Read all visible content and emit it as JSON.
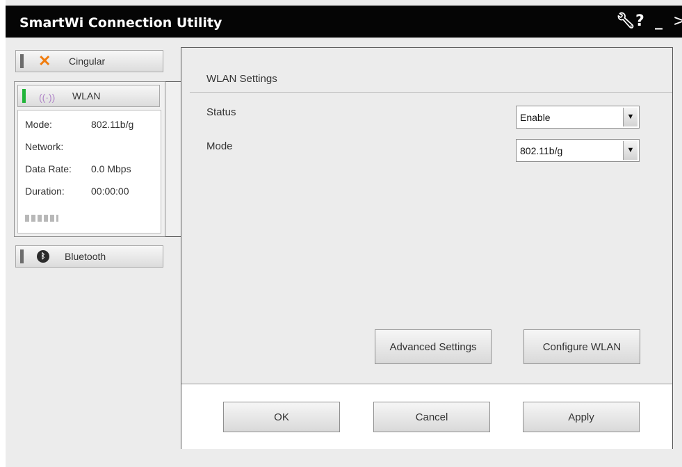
{
  "window": {
    "title": "SmartWi Connection Utility"
  },
  "title_controls": {
    "settings": "✎",
    "help": "?",
    "minimize": "_",
    "close": ">"
  },
  "sidebar": {
    "items": [
      {
        "label": "Cingular",
        "icon": "cingular-logo-icon"
      },
      {
        "label": "WLAN",
        "icon": "wifi-signal-icon",
        "selected": true
      },
      {
        "label": "Bluetooth",
        "icon": "bluetooth-icon"
      }
    ],
    "wlan_info": {
      "mode_label": "Mode:",
      "mode_value": "802.11b/g",
      "network_label": "Network:",
      "network_value": "",
      "rate_label": "Data Rate:",
      "rate_value": "0.0 Mbps",
      "duration_label": "Duration:",
      "duration_value": "00:00:00"
    }
  },
  "panel": {
    "title": "WLAN Settings",
    "status": {
      "label": "Status",
      "value": "Enable"
    },
    "mode": {
      "label": "Mode",
      "value": "802.11b/g"
    },
    "advanced_label": "Advanced Settings",
    "configure_label": "Configure WLAN"
  },
  "footer": {
    "ok": "OK",
    "cancel": "Cancel",
    "apply": "Apply"
  },
  "colors": {
    "titlebar": "#050505",
    "accent_green": "#22b53a",
    "cingular_orange": "#f07c0e"
  }
}
